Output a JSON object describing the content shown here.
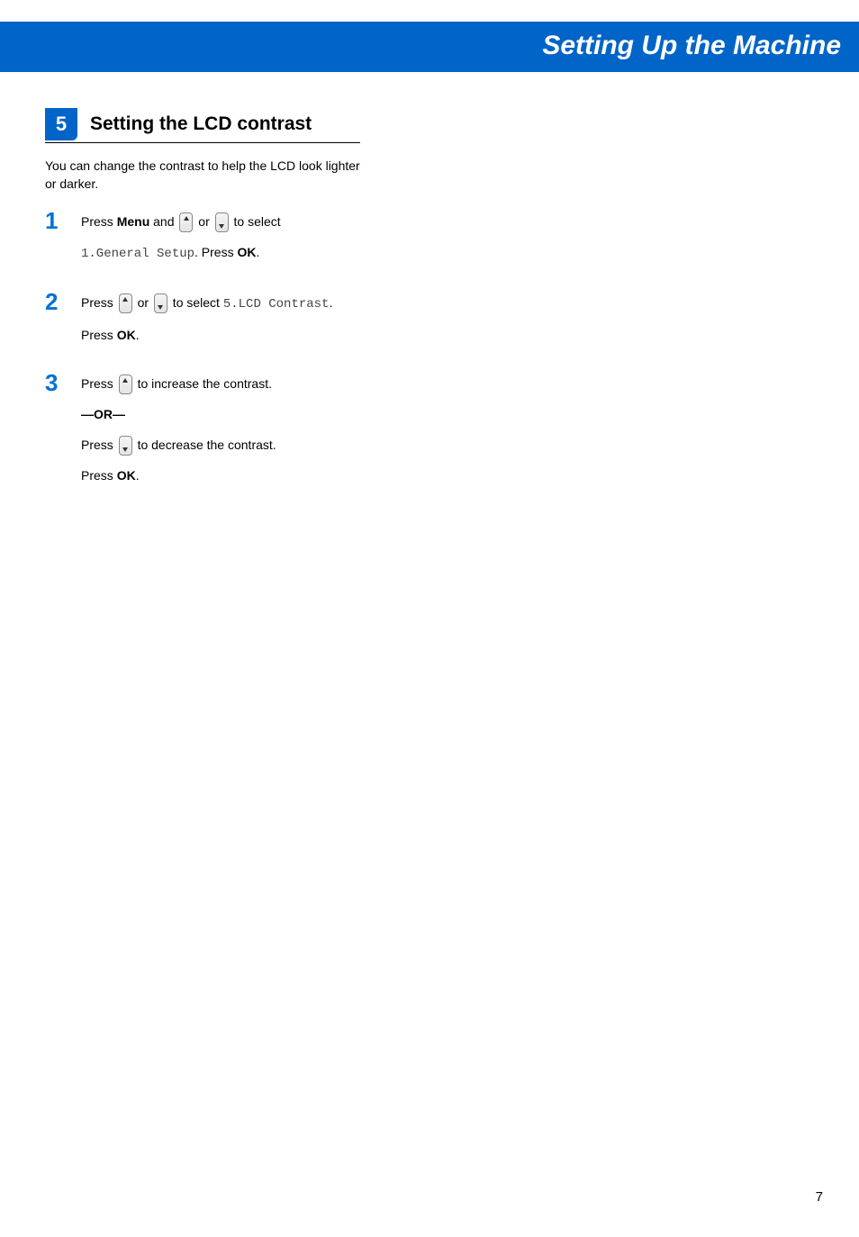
{
  "header": {
    "title": "Setting Up the Machine"
  },
  "section": {
    "number": "5",
    "title": "Setting the LCD contrast"
  },
  "intro": "You can change the contrast to help the LCD look lighter or darker.",
  "steps": [
    {
      "num": "1",
      "parts": {
        "t1": "Press ",
        "menu": "Menu",
        "t2": " and ",
        "t3": " or ",
        "t4": "  to select ",
        "mono": "1.General Setup",
        "t5": ". Press ",
        "ok": "OK",
        "t6": "."
      }
    },
    {
      "num": "2",
      "parts": {
        "t1": "Press ",
        "t2": " or ",
        "t3": " to select ",
        "mono": "5.LCD Contrast",
        "t4": ". ",
        "t5": "Press ",
        "ok": "OK",
        "t6": "."
      }
    },
    {
      "num": "3",
      "parts": {
        "t1": "Press ",
        "t2": " to increase the contrast.",
        "or": "—OR—",
        "t3": "Press ",
        "t4": "  to decrease the contrast.",
        "t5": "Press ",
        "ok": "OK",
        "t6": "."
      }
    }
  ],
  "pageNumber": "7"
}
